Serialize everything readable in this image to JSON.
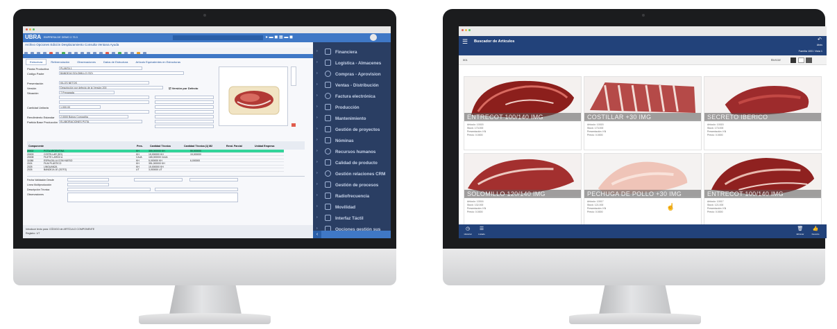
{
  "left_app": {
    "title": "UBRA",
    "company": "EMPRESA DE DEMO 2.75.3",
    "menu": "Archivo  Opciones  Edición  Desplazamiento  Consulta  Ventana  Ayuda",
    "tabs": [
      "Estructura",
      "Referenciación",
      "Observaciones",
      "Datos de Estructura",
      "Artículo Equivalentes en Estructuras"
    ],
    "fields": [
      {
        "label": "Planta Productiva",
        "value": "PLANTA 1"
      },
      {
        "label": "Código Padre",
        "value": "BANDEJA SOLOMILLO (SO)"
      },
      {
        "label": "Presentación",
        "value": "KILOS NETOS"
      },
      {
        "label": "Versión",
        "value": "Descripción por defecto de la Versión 200"
      },
      {
        "label": "Situación",
        "value": "T Preparada"
      },
      {
        "label": "Cantidad Unitaria",
        "value": "1.000,00"
      },
      {
        "label": "Rendimiento Estandar",
        "value": "2,0000 Bobos Compañía"
      },
      {
        "label": "Partida Base Producción",
        "value": "ELABORACIONES POTA"
      }
    ],
    "check_label": "Versión por Defecto",
    "table_header": [
      "Componente",
      "Pres.",
      "Cantidad Técnica",
      "Cantidad Técnica (1) M2",
      "Rend. Parcial",
      "Unidad Empresa"
    ],
    "table_rows": [
      [
        "20002",
        "POTA ARGENTINA",
        "KH",
        "355,000000 KH",
        "55,000000"
      ],
      [
        "20003",
        "COSTILLAR (SO)",
        "KH",
        "15,000000 KH",
        "15,000000"
      ],
      [
        "20008",
        "FILETE LARGO A",
        "CAJA",
        "165,000000 CAJA",
        ""
      ],
      [
        "11088",
        "ESPALDILLA CON HUESO",
        "KH",
        "5,000000 KH",
        "6,000000"
      ],
      [
        "2024",
        "FILM PLÁSTICO",
        "KH",
        "351,000000 KH",
        ""
      ],
      [
        "2025",
        "LINGUANZA",
        "KH",
        "15,000000 KH",
        ""
      ],
      [
        "2026",
        "BANDEJA 1E (SOTO)",
        "UT",
        "3,000000 UT",
        ""
      ]
    ],
    "footer_fields": [
      "Fecha Validación Desde",
      "Línea Multiproducción",
      "Descripción Técnica",
      "Observaciones"
    ],
    "status_text": "Introduce texto para: CÓDIGO de ARTÍCULO COMPONENTE",
    "status_sub": "Registro: 1/7"
  },
  "sidebar": {
    "items": [
      {
        "label": "Financiera",
        "icon": "euro-icon"
      },
      {
        "label": "Logística - Almacenes",
        "icon": "truck-icon"
      },
      {
        "label": "Compras - Aprovision",
        "icon": "euro-circle-icon"
      },
      {
        "label": "Ventas - Distribución",
        "icon": "cart-icon"
      },
      {
        "label": "Factura electrónica",
        "icon": "document-icon"
      },
      {
        "label": "Producción",
        "icon": "factory-icon"
      },
      {
        "label": "Mantenimiento",
        "icon": "tools-icon"
      },
      {
        "label": "Gestión de proyectos",
        "icon": "list-icon"
      },
      {
        "label": "Nóminas",
        "icon": "payroll-icon"
      },
      {
        "label": "Recursos humanos",
        "icon": "people-icon"
      },
      {
        "label": "Calidad de producto",
        "icon": "quality-icon"
      },
      {
        "label": "Gestión relaciones CRM",
        "icon": "crm-icon"
      },
      {
        "label": "Gestión de procesos",
        "icon": "process-icon"
      },
      {
        "label": "Radiofrecuencia",
        "icon": "radio-icon"
      },
      {
        "label": "Movilidad",
        "icon": "mobile-icon"
      },
      {
        "label": "Interfaz Táctil",
        "icon": "touch-icon"
      },
      {
        "label": "Opciones gestión sus",
        "icon": "folder-icon"
      }
    ]
  },
  "right_app": {
    "title": "Buscador de Artículos",
    "search_value": "001",
    "search_button": "Buscar",
    "filter_label": "Familia 1001 Vista 1",
    "back_label": "Atrás",
    "cards": [
      {
        "name": "ENTRECOT 100/140 IMG",
        "lines": [
          "Artículo: 10015",
          "Stock: 173.000",
          "Presentación: KN",
          "Precio: 0.0000"
        ]
      },
      {
        "name": "COSTILLAR +30 IMG",
        "lines": [
          "Artículo: 10015",
          "Stock: 173.000",
          "Presentación: KN",
          "Precio: 0.0000"
        ]
      },
      {
        "name": "SECRETO IBERICO",
        "lines": [
          "Artículo: 10015",
          "Stock: 173.000",
          "Presentación: KN",
          "Precio: 0.0000"
        ]
      },
      {
        "name": "SOLOMILLO 120/140 IMG",
        "lines": [
          "Artículo: 10016",
          "Stock: 132.000",
          "Presentación: KN",
          "Precio: 0.0000"
        ]
      },
      {
        "name": "PECHUGA DE POLLO +30 IMG",
        "lines": [
          "Artículo: 10017",
          "Stock: 121.000",
          "Presentación: KN",
          "Precio: 0.0000"
        ]
      },
      {
        "name": "ENTRECOT 100/140 IMG",
        "lines": [
          "Artículo: 10017",
          "Stock: 121.000",
          "Presentación: KN",
          "Precio: 0.0000"
        ]
      }
    ],
    "bottom_left": [
      "Historial",
      "Listado"
    ],
    "bottom_right": [
      "Eliminar",
      "Favorito"
    ]
  }
}
